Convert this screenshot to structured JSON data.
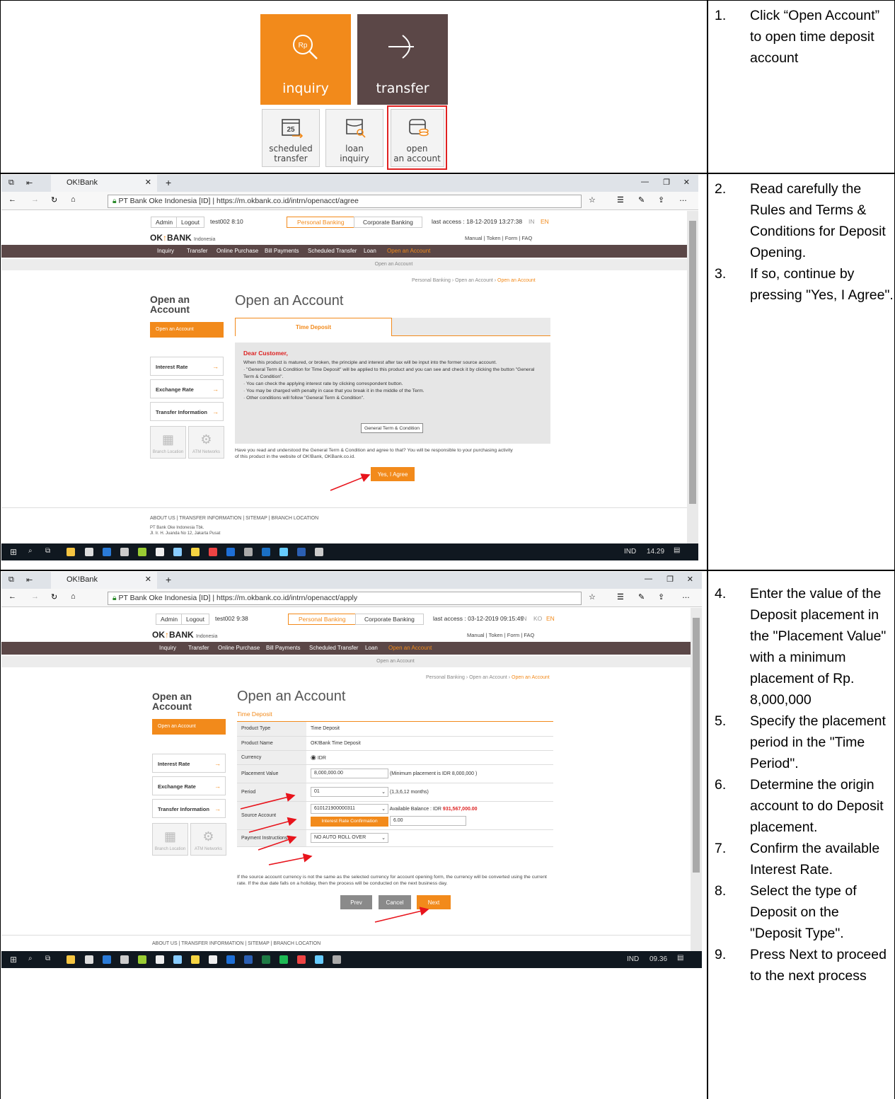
{
  "steps": {
    "s1": "Click “Open Account” to open time deposit account",
    "s2": "Read carefully the Rules and Terms & Conditions for Deposit Opening.",
    "s3": "If so, continue by pressing \"Yes, I Agree\".",
    "s4": "Enter the value of the Deposit placement in the \"Placement Value\" with a minimum placement of Rp. 8,000,000",
    "s5": "Specify the placement period in the \"Time Period\".",
    "s6": "Determine the origin account to do Deposit placement.",
    "s7": "Confirm the available Interest Rate.",
    "s8": "Select the type of Deposit on the \"Deposit Type\".",
    "s9": "Press Next to proceed to the next process",
    "n1": "1.",
    "n2": "2.",
    "n3": "3.",
    "n4": "4.",
    "n5": "5.",
    "n6": "6.",
    "n7": "7.",
    "n8": "8.",
    "n9": "9."
  },
  "menu": {
    "inquiry": "inquiry",
    "transfer": "transfer",
    "scheduled_1": "scheduled",
    "scheduled_2": "transfer",
    "scheduled_day": "25",
    "loan_1": "loan",
    "loan_2": "inquiry",
    "open_1": "open",
    "open_2": "an account",
    "rp": "Rp"
  },
  "browser": {
    "tab_title": "OK!Bank",
    "site": "PT Bank Oke Indonesia [ID]",
    "url1": "https://m.okbank.co.id/intrn/openacct/agree",
    "url2": "https://m.okbank.co.id/intrn/openacct/apply"
  },
  "site": {
    "admin": "Admin",
    "logout": "Logout",
    "user1": "test002 8:10",
    "user2": "test002 9:38",
    "personal": "Personal Banking",
    "corporate": "Corporate Banking",
    "last1": "last access : 18-12-2019 13:27:38",
    "last2": "last access : 03-12-2019 09:15:49",
    "lang_in": "IN",
    "lang_ko": "KO",
    "lang_en": "EN",
    "logo": "OK",
    "logo2": "BANK",
    "logo_sub": "Indonesia",
    "manual": "Manual",
    "token": "Token",
    "form": "Form",
    "faq": "FAQ",
    "nav": [
      "Inquiry",
      "Transfer",
      "Online Purchase",
      "Bill Payments",
      "Scheduled Transfer",
      "Loan",
      "Open an Account"
    ],
    "sub": "Open an Account",
    "crumb_a": "Personal Banking › Open an Account › ",
    "crumb_b": "Open an Account",
    "left_title": "Open an Account",
    "left_btn": "Open an Account",
    "side": [
      "Interest Rate",
      "Exchange Rate",
      "Transfer Information"
    ],
    "branch": "Branch Location",
    "atm": "ATM Networks",
    "title": "Open an Account",
    "footer_links": "ABOUT US  |  TRANSFER INFORMATION  |  SITEMAP  |  BRANCH LOCATION",
    "footer_addr1": "PT Bank Oke Indonesia Tbk.",
    "footer_addr2": "Jl. Ir. H. Juanda No 12, Jakarta Pusat"
  },
  "agree": {
    "tab": "Time Deposit",
    "dear": "Dear Customer,",
    "b1": "When this product is matured, or broken, the principle and interest after tax will be input into the former source account.",
    "b2": "· \"General Term & Condition for Time Deposit\" will be applied to this product and you can see and check it by clicking the button \"General Term & Condition\".",
    "b3": "· You can check the applying interest rate by clicking correspondent button.",
    "b4": "· You may be charged with penalty in case that you break it in the middle of the Term.",
    "b5": "· Other conditions will follow \"General Term & Condition\".",
    "gtc": "General Term & Condition",
    "question": "Have you read and understood the General Term & Condition and agree to that? You will be responsible to your purchasing activity of this product in the website of OK!Bank, OKBank.co.id.",
    "yes": "Yes, I Agree"
  },
  "apply": {
    "subtitle": "Time Deposit",
    "product_type_l": "Product Type",
    "product_type_v": "Time Deposit",
    "product_name_l": "Product Name",
    "product_name_v": "OK!Bank Time Deposit",
    "currency_l": "Currency",
    "currency_v": "IDR",
    "placement_l": "Placement Value",
    "placement_v": "8,000,000.00",
    "placement_note": "(Minimum placement is IDR 8,000,000 )",
    "period_l": "Period",
    "period_v": "01",
    "period_note": "(1,3,6,12 months)",
    "source_l": "Source Account",
    "source_v": "610121900000311",
    "balance_l": "Available Balance : IDR ",
    "balance_v": "931,567,000.00",
    "rate_btn": "Interest Rate Confirmation",
    "rate_v": "6.00",
    "payment_l": "Payment Instructions",
    "payment_v": "NO AUTO ROLL OVER",
    "note": "If the source account currency is not the same as the selected currency for account opening form, the currency will be converted using the current rate. If the due date falls on a holiday, then the process will be conducted on the next business day.",
    "prev": "Prev",
    "cancel": "Cancel",
    "next": "Next"
  },
  "taskbar": {
    "lang": "IND",
    "time1": "14.29",
    "time2": "09.36"
  },
  "icons": {
    "colors": {
      "orange": "#f28a1b",
      "brown": "#5b4747",
      "red_box": "#e02020",
      "arrow": "#e8141c"
    }
  }
}
